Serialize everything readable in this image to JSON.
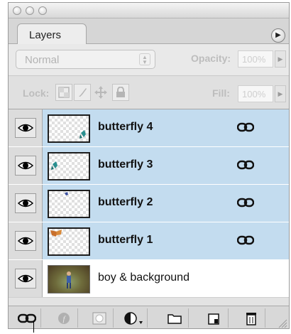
{
  "panel": {
    "tab_label": "Layers",
    "menu_button_glyph": "▶",
    "blend_mode": "Normal",
    "opacity_label": "Opacity:",
    "opacity_value": "100%",
    "lock_label": "Lock:",
    "fill_label": "Fill:",
    "fill_value": "100%"
  },
  "layers": [
    {
      "name": "butterfly 4",
      "selected": true,
      "visible": true,
      "linked": true
    },
    {
      "name": "butterfly 3",
      "selected": true,
      "visible": true,
      "linked": true
    },
    {
      "name": "butterfly 2",
      "selected": true,
      "visible": true,
      "linked": true
    },
    {
      "name": "butterfly 1",
      "selected": true,
      "visible": true,
      "linked": true
    },
    {
      "name": "boy & background",
      "selected": false,
      "visible": true,
      "linked": false
    }
  ],
  "bottom_toolbar": [
    "link-layers-icon",
    "layer-style-icon",
    "layer-mask-icon",
    "adjustment-layer-icon",
    "new-group-icon",
    "new-layer-icon",
    "trash-icon"
  ],
  "colors": {
    "selected_row": "#c3dcef",
    "panel_bg": "#e3e3e3"
  }
}
